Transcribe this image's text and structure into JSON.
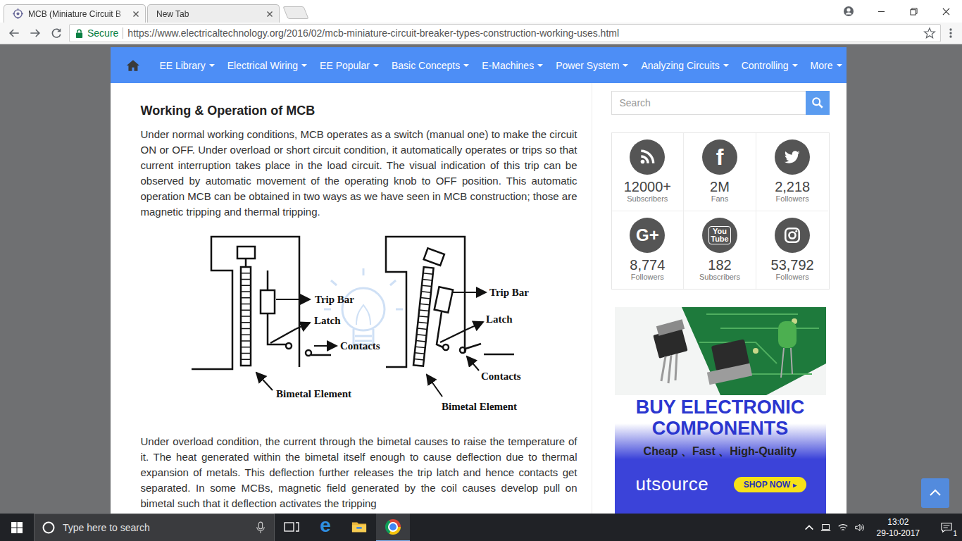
{
  "browser": {
    "tabs": [
      {
        "label": "MCB (Miniature Circuit B",
        "selected": true,
        "has_icon": true
      },
      {
        "label": "New Tab",
        "selected": false,
        "has_icon": false
      }
    ],
    "address_bar": {
      "secure_label": "Secure",
      "url": "https://www.electricaltechnology.org/2016/02/mcb-miniature-circuit-breaker-types-construction-working-uses.html",
      "bookmarked": false
    }
  },
  "site": {
    "nav": [
      {
        "label": "EE Library"
      },
      {
        "label": "Electrical Wiring"
      },
      {
        "label": "EE Popular"
      },
      {
        "label": "Basic Concepts"
      },
      {
        "label": "E-Machines"
      },
      {
        "label": "Power System"
      },
      {
        "label": "Analyzing Circuits"
      },
      {
        "label": "Controlling"
      },
      {
        "label": "More"
      }
    ],
    "article": {
      "heading": "Working & Operation of MCB",
      "paragraphs": [
        "Under normal working conditions, MCB operates as a switch (manual one) to make the circuit ON or OFF. Under overload or short circuit condition, it automatically operates or trips so that current interruption takes place in the load circuit. The visual indication of this trip can be observed by automatic movement of the operating knob to OFF position. This automatic operation MCB can be obtained in two ways as we have seen in MCB construction; those are magnetic tripping and thermal tripping.",
        "Under overload condition, the current through the bimetal causes to raise the temperature of it. The heat generated within the bimetal itself enough to cause deflection due to thermal expansion of metals. This deflection further releases the trip latch and hence contacts get separated. In some MCBs, magnetic field generated by the coil causes develop pull on bimetal such that it deflection activates the tripping"
      ],
      "diagram": {
        "figures": [
          {
            "tripped": false,
            "labels": [
              "Trip Bar",
              "Latch",
              "Contacts",
              "Bimetal Element"
            ]
          },
          {
            "tripped": true,
            "labels": [
              "Trip Bar",
              "Latch",
              "Contacts",
              "Bimetal Element"
            ]
          }
        ]
      }
    },
    "sidebar": {
      "search": {
        "placeholder": "Search"
      },
      "social": [
        {
          "kind": "rss",
          "glyph": "",
          "count": "12000+",
          "label": "Subscribers"
        },
        {
          "kind": "facebook",
          "glyph": "f",
          "count": "2M",
          "label": "Fans"
        },
        {
          "kind": "twitter",
          "glyph": "",
          "count": "2,218",
          "label": "Followers"
        },
        {
          "kind": "google-plus",
          "glyph": "G+",
          "count": "8,774",
          "label": "Followers"
        },
        {
          "kind": "youtube",
          "glyph": "You Tube",
          "count": "182",
          "label": "Subscribers"
        },
        {
          "kind": "instagram",
          "glyph": "",
          "count": "53,792",
          "label": "Followers"
        }
      ],
      "ad": {
        "headline": [
          "BUY ELECTRONIC",
          "COMPONENTS"
        ],
        "tagline": "Cheap 、Fast 、High-Quality",
        "brand": "utsource",
        "button": "SHOP NOW",
        "button_arrow": "▸"
      }
    }
  },
  "taskbar": {
    "search_placeholder": "Type here to search",
    "apps": [
      {
        "kind": "task-view",
        "glyph": "",
        "active": false
      },
      {
        "kind": "edge",
        "glyph": "e",
        "active": false
      },
      {
        "kind": "file-explorer",
        "glyph": "",
        "active": false
      },
      {
        "kind": "chrome",
        "glyph": "",
        "active": true
      }
    ],
    "time": "13:02",
    "date": "29-10-2017",
    "notifications": "1"
  }
}
